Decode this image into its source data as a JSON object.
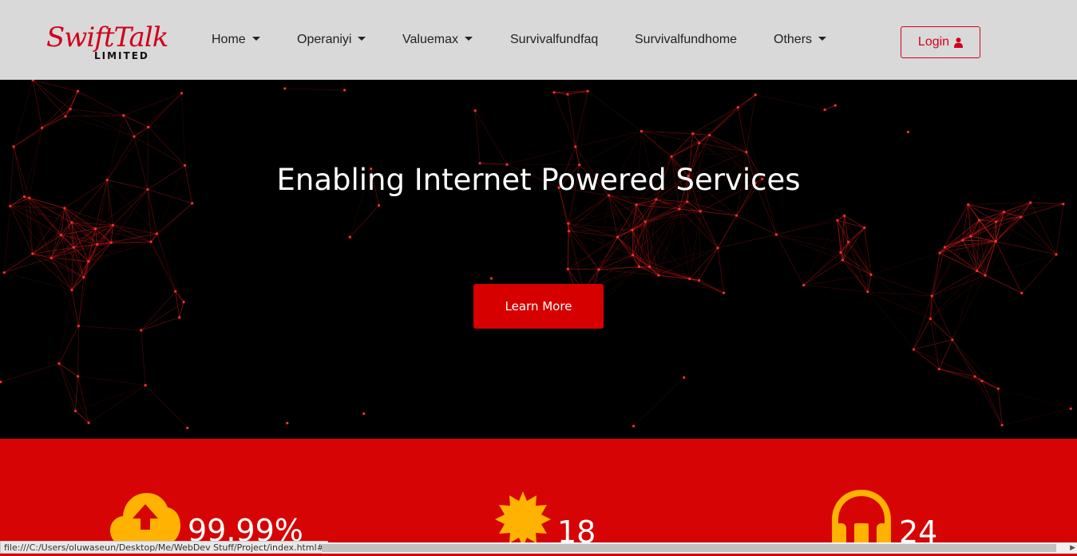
{
  "brand": {
    "name": "SwiftTalk",
    "tagline": "LIMITED"
  },
  "nav": {
    "items": [
      {
        "label": "Home",
        "dropdown": true
      },
      {
        "label": "Operaniyi",
        "dropdown": true
      },
      {
        "label": "Valuemax",
        "dropdown": true
      },
      {
        "label": "Survivalfundfaq",
        "dropdown": false
      },
      {
        "label": "Survivalfundhome",
        "dropdown": false
      },
      {
        "label": "Others",
        "dropdown": true
      }
    ],
    "login_label": "Login"
  },
  "hero": {
    "title": "Enabling Internet Powered Services",
    "cta_label": "Learn More"
  },
  "stats": [
    {
      "icon": "cloud-upload-icon",
      "value": "99.99%"
    },
    {
      "icon": "sun-badge-icon",
      "value": "18"
    },
    {
      "icon": "headphones-icon",
      "value": "24"
    }
  ],
  "status_bar": {
    "url": "file:///C:/Users/oluwaseun/Desktop/Me/WebDev Stuff/Project/index.html#"
  },
  "colors": {
    "accent": "#d60404",
    "nav_bg": "#d9d9d9",
    "icon": "#ffb300"
  }
}
